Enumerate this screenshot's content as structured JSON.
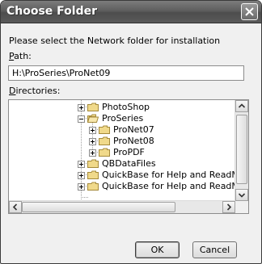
{
  "window": {
    "title": "Choose Folder"
  },
  "prompt": "Please select the Network folder for installation",
  "path": {
    "label_first": "P",
    "label_rest": "ath:",
    "value": "H:\\ProSeries\\ProNet09"
  },
  "directories": {
    "label_first": "D",
    "label_rest": "irectories:",
    "items": [
      {
        "label": "PhotoShop",
        "expander": "plus"
      },
      {
        "label": "ProSeries",
        "expander": "minus"
      },
      {
        "label": "ProNet07",
        "expander": "plus"
      },
      {
        "label": "ProNet08",
        "expander": "plus"
      },
      {
        "label": "ProPDF",
        "expander": "plus"
      },
      {
        "label": "QBDataFiles",
        "expander": "plus"
      },
      {
        "label": "QuickBase for Help and ReadMe files",
        "expander": "plus"
      },
      {
        "label": "QuickBase for Help and ReadMe files",
        "expander": "plus"
      }
    ]
  },
  "buttons": {
    "ok": "OK",
    "cancel": "Cancel"
  },
  "icons": {
    "close": "close-icon",
    "folder": "folder-icon",
    "scroll_up": "arrow-up-icon",
    "scroll_down": "arrow-down-icon",
    "scroll_left": "arrow-left-icon",
    "scroll_right": "arrow-right-icon"
  },
  "colors": {
    "titlebar": "#5e5e5e",
    "folder": "#f0d98a"
  }
}
